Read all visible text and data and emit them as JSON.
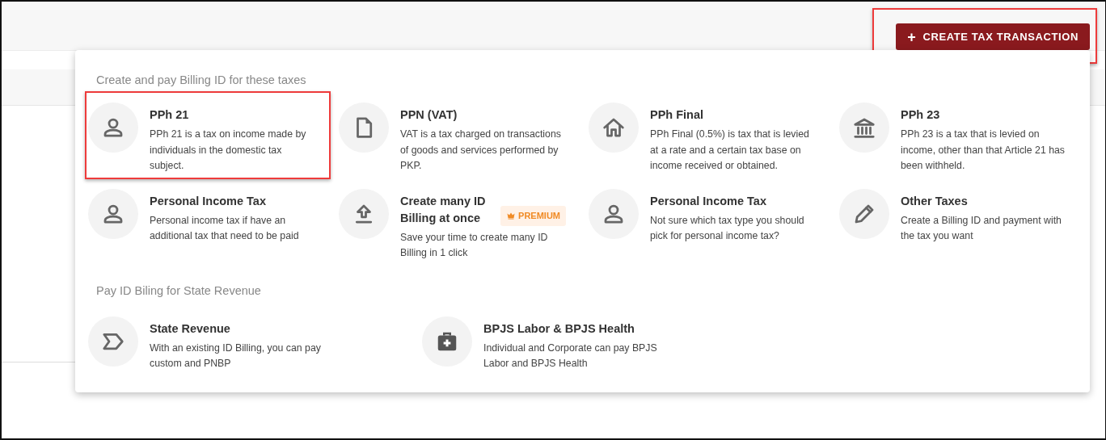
{
  "header": {
    "create_button": {
      "icon": "+",
      "label": "CREATE TAX TRANSACTION",
      "highlighted": true
    }
  },
  "menu": {
    "sections": [
      {
        "heading": "Create and pay Billing ID for these taxes",
        "items": [
          {
            "title": "PPh 21",
            "description": "PPh 21 is a tax on income made by individuals in the domestic tax subject.",
            "highlighted": true
          },
          {
            "title": "PPN (VAT)",
            "description": "VAT is a tax charged on transactions of goods and services performed by PKP.",
            "highlighted": false
          },
          {
            "title": "PPh Final",
            "description": "PPh Final (0.5%) is tax that is levied at a rate and a certain tax base on income received or obtained.",
            "highlighted": false
          },
          {
            "title": "PPh 23",
            "description": "PPh 23 is a tax that is levied on income, other than that Article 21 has been withheld.",
            "highlighted": false
          },
          {
            "title": "Personal Income Tax",
            "description": "Personal income tax if have an additional tax that need to be paid",
            "highlighted": false
          },
          {
            "title": "Create many ID Billing at once",
            "badge": "PREMIUM",
            "description": "Save your time to create many ID Billing in 1 click",
            "highlighted": false
          },
          {
            "title": "Personal Income Tax",
            "description": "Not sure which tax type you should pick for personal income tax?",
            "highlighted": false
          },
          {
            "title": "Other Taxes",
            "description": "Create a Billing ID and payment with the tax you want",
            "highlighted": false
          }
        ]
      },
      {
        "heading": "Pay ID Biling for State Revenue",
        "items": [
          {
            "title": "State Revenue",
            "description": "With an existing ID Billing, you can pay custom and PNBP",
            "highlighted": false
          },
          {
            "title": "BPJS Labor & BPJS Health",
            "description": "Individual and Corporate can pay BPJS Labor and BPJS Health",
            "highlighted": false
          }
        ]
      }
    ]
  }
}
